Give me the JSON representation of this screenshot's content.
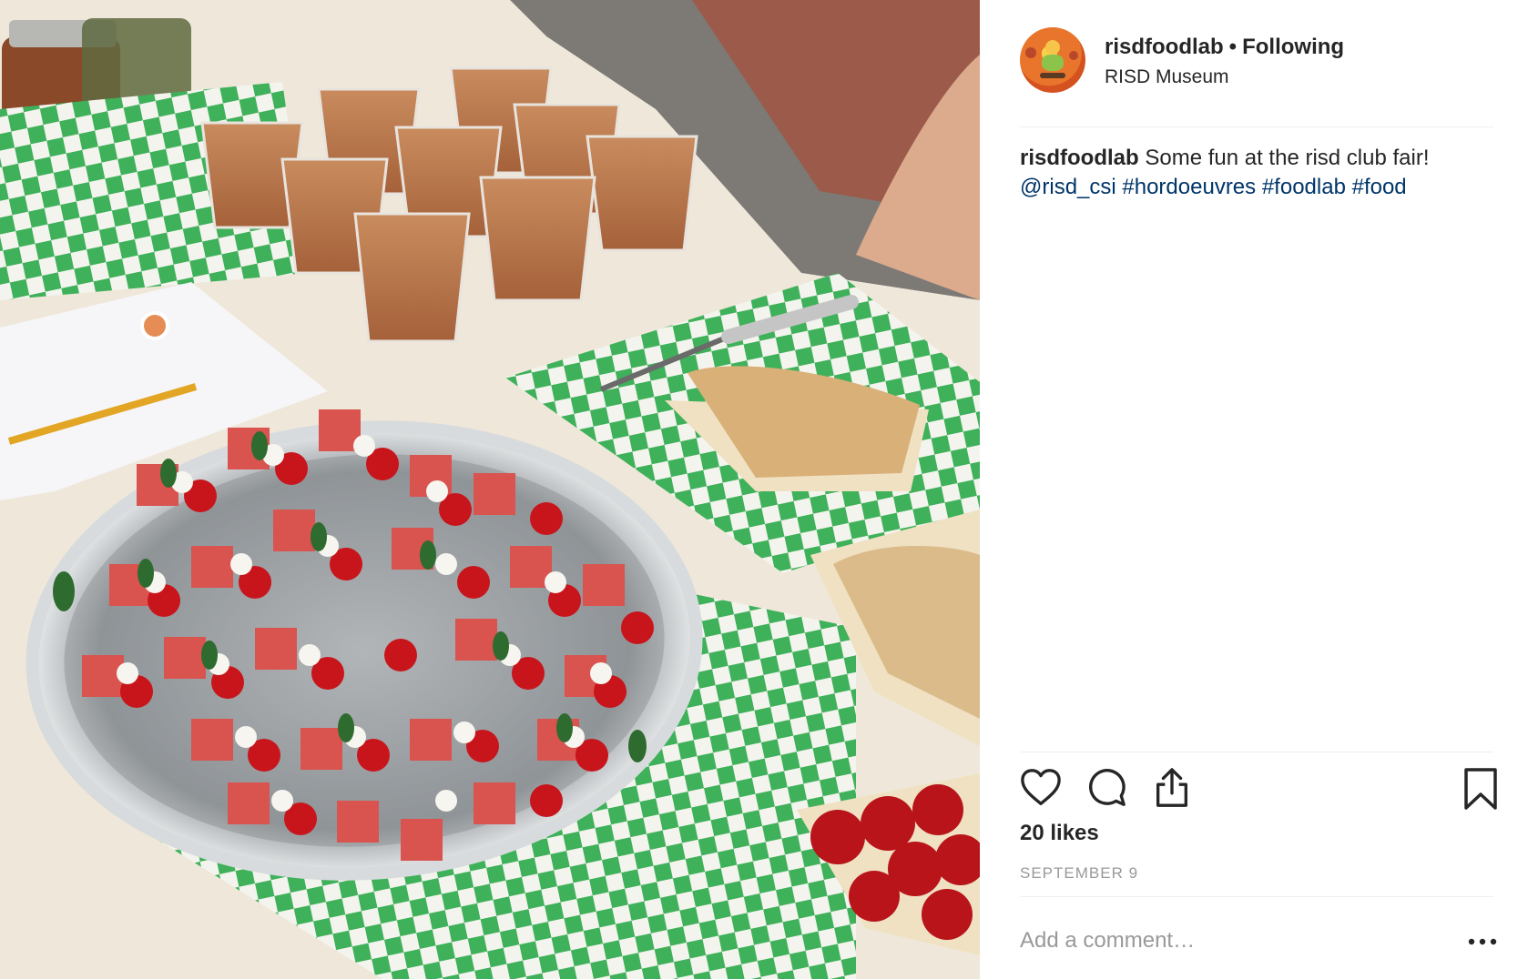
{
  "post": {
    "username": "risdfoodlab",
    "separator": "•",
    "follow_status": "Following",
    "location": "RISD Museum",
    "caption_user": "risdfoodlab",
    "caption_text": "Some fun at the risd club fair!",
    "caption_tags": [
      "@risd_csi",
      "#hordoeuvres",
      "#foodlab",
      "#food"
    ],
    "likes": "20 likes",
    "date": "SEPTEMBER 9"
  },
  "comment": {
    "placeholder": "Add a comment…"
  },
  "icons": {
    "like": "heart-icon",
    "comment": "comment-bubble-icon",
    "share": "share-icon",
    "save": "bookmark-icon",
    "more": "more-options-icon"
  },
  "colors": {
    "link": "#003569",
    "muted": "#999999",
    "text": "#262626"
  }
}
